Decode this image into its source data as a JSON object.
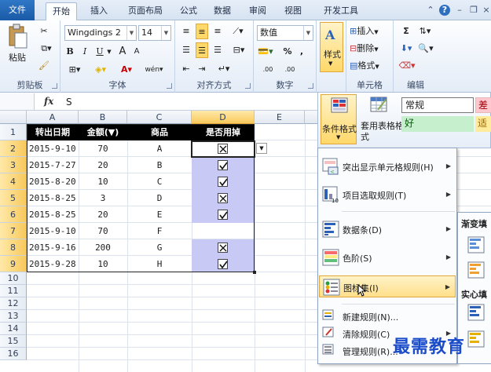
{
  "ribbon_tabs": {
    "file": "文件",
    "home": "开始",
    "insert": "插入",
    "layout": "页面布局",
    "formula": "公式",
    "data": "数据",
    "review": "审阅",
    "view": "视图",
    "developer": "开发工具"
  },
  "clipboard": {
    "paste": "粘贴",
    "group": "剪贴板"
  },
  "font": {
    "name": "Wingdings 2",
    "size": "14",
    "bold": "B",
    "italic": "I",
    "underline": "U",
    "grow": "A",
    "shrink": "A",
    "group": "字体"
  },
  "alignment": {
    "group": "对齐方式"
  },
  "number": {
    "format": "数值",
    "percent": "%",
    "comma": ",",
    "inc_decimal": ".00",
    "dec_decimal": ".00",
    "group": "数字"
  },
  "styles": {
    "button": "样式",
    "cond_format": "条件格式",
    "table_format": "套用表格格式",
    "preset_normal": "常规",
    "preset_bad": "差",
    "preset_good": "好",
    "preset_neutral": "适"
  },
  "cells": {
    "insert": "插入",
    "delete": "删除",
    "format": "格式",
    "group": "单元格"
  },
  "editing": {
    "sum": "Σ",
    "group": "编辑"
  },
  "formula_bar": {
    "fx": "fx",
    "value": "S"
  },
  "columns": [
    "A",
    "B",
    "C",
    "D",
    "E"
  ],
  "rows": [
    "1",
    "2",
    "3",
    "4",
    "5",
    "6",
    "7",
    "8",
    "9",
    "10",
    "11",
    "12",
    "13",
    "14",
    "15",
    "16"
  ],
  "table": {
    "headers": [
      "转出日期",
      "金额(▼)",
      "商品",
      "是否用掉"
    ],
    "rows": [
      {
        "date": "2015-9-10",
        "amount": "70",
        "item": "A",
        "used": "x"
      },
      {
        "date": "2015-7-27",
        "amount": "20",
        "item": "B",
        "used": "check"
      },
      {
        "date": "2015-8-20",
        "amount": "10",
        "item": "C",
        "used": "check"
      },
      {
        "date": "2015-8-25",
        "amount": "3",
        "item": "D",
        "used": "x"
      },
      {
        "date": "2015-8-25",
        "amount": "20",
        "item": "E",
        "used": "check"
      },
      {
        "date": "2015-9-10",
        "amount": "70",
        "item": "F",
        "used": ""
      },
      {
        "date": "2015-9-16",
        "amount": "200",
        "item": "G",
        "used": "x"
      },
      {
        "date": "2015-9-28",
        "amount": "10",
        "item": "H",
        "used": "check"
      }
    ]
  },
  "cf_menu": {
    "highlight_rules": "突出显示单元格规则(H)",
    "top_bottom": "项目选取规则(T)",
    "data_bars": "数据条(D)",
    "color_scales": "色阶(S)",
    "icon_sets": "图标集(I)",
    "new_rule": "新建规则(N)...",
    "clear_rules": "清除规则(C)",
    "manage_rules": "管理规则(R)..."
  },
  "submenu": {
    "gradient": "渐变填",
    "solid": "实心填"
  },
  "watermark": "最需教育",
  "colors": {
    "accent": "#2f78c7",
    "selected_col": "#f8c95d",
    "check_fill": "#c9c9f5",
    "menu_hover": "#ffe39a"
  }
}
